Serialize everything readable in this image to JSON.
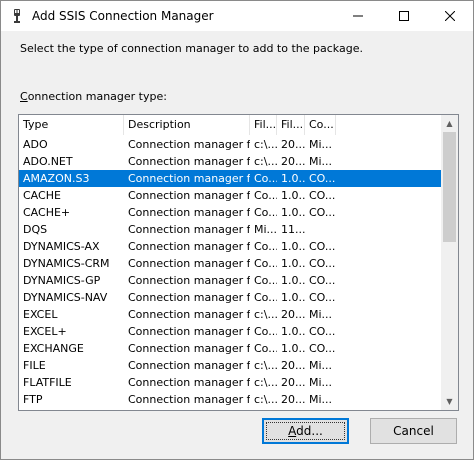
{
  "window": {
    "title": "Add SSIS Connection Manager"
  },
  "dialog": {
    "instruction": "Select the type of connection manager to add to the package.",
    "type_label_underlined": "C",
    "type_label_rest": "onnection manager type:"
  },
  "list": {
    "headers": [
      "Type",
      "Description",
      "Fil...",
      "Fil...",
      "Co..."
    ],
    "rows": [
      [
        "ADO",
        "Connection manager f...",
        "c:\\...",
        "20...",
        "Mi..."
      ],
      [
        "ADO.NET",
        "Connection manager f...",
        "c:\\...",
        "20...",
        "Mi..."
      ],
      [
        "AMAZON.S3",
        "Connection manager f...",
        "Co...",
        "1.0...",
        "CO..."
      ],
      [
        "CACHE",
        "Connection manager f...",
        "Co...",
        "1.0...",
        "CO..."
      ],
      [
        "CACHE+",
        "Connection manager f...",
        "Co...",
        "1.0...",
        "CO..."
      ],
      [
        "DQS",
        "Connection manager f...",
        "Mi...",
        "11....",
        ""
      ],
      [
        "DYNAMICS-AX",
        "Connection manager f...",
        "Co...",
        "1.0...",
        "CO..."
      ],
      [
        "DYNAMICS-CRM",
        "Connection manager f...",
        "Co...",
        "1.0...",
        "CO..."
      ],
      [
        "DYNAMICS-GP",
        "Connection manager f...",
        "Co...",
        "1.0...",
        "CO..."
      ],
      [
        "DYNAMICS-NAV",
        "Connection manager f...",
        "Co...",
        "1.0...",
        "CO..."
      ],
      [
        "EXCEL",
        "Connection manager f...",
        "c:\\...",
        "20...",
        "Mi..."
      ],
      [
        "EXCEL+",
        "Connection manager f...",
        "Co...",
        "1.0...",
        "CO..."
      ],
      [
        "EXCHANGE",
        "Connection manager f...",
        "Co...",
        "1.0...",
        "CO..."
      ],
      [
        "FILE",
        "Connection manager f...",
        "c:\\...",
        "20...",
        "Mi..."
      ],
      [
        "FLATFILE",
        "Connection manager f...",
        "c:\\...",
        "20...",
        "Mi..."
      ],
      [
        "FTP",
        "Connection manager f...",
        "c:\\...",
        "20...",
        "Mi..."
      ]
    ],
    "selected_index": 2,
    "selection_color": "#0078d7"
  },
  "buttons": {
    "add_underlined": "A",
    "add_rest": "dd...",
    "cancel": "Cancel"
  },
  "icons": {
    "app": "ssis-plug-icon",
    "minimize": "minimize-icon",
    "maximize": "maximize-icon",
    "close": "close-icon",
    "scroll_up": "chevron-up-icon",
    "scroll_down": "chevron-down-icon"
  }
}
